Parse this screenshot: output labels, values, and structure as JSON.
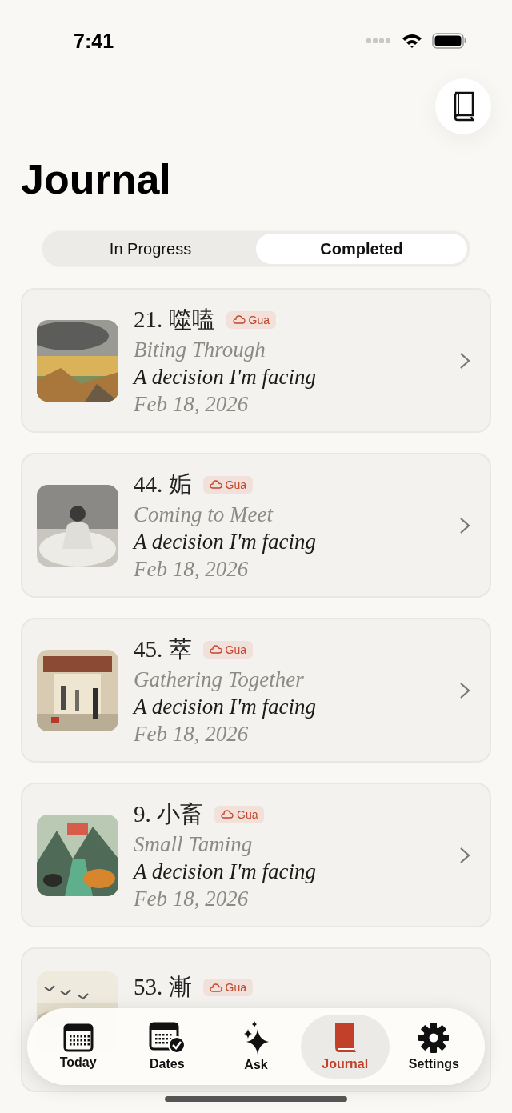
{
  "status_bar": {
    "time": "7:41"
  },
  "header": {
    "title": "Journal"
  },
  "segments": [
    {
      "label": "In Progress",
      "selected": false
    },
    {
      "label": "Completed",
      "selected": true
    }
  ],
  "entries": [
    {
      "number": "21.",
      "glyph": "噬嗑",
      "badge": "Gua",
      "name": "Biting Through",
      "question": "A decision I'm facing",
      "date": "Feb 18, 2026"
    },
    {
      "number": "44.",
      "glyph": "姤",
      "badge": "Gua",
      "name": "Coming to Meet",
      "question": "A decision I'm facing",
      "date": "Feb 18, 2026"
    },
    {
      "number": "45.",
      "glyph": "萃",
      "badge": "Gua",
      "name": "Gathering Together",
      "question": "A decision I'm facing",
      "date": "Feb 18, 2026"
    },
    {
      "number": "9.",
      "glyph": "小畜",
      "badge": "Gua",
      "name": "Small Taming",
      "question": "A decision I'm facing",
      "date": "Feb 18, 2026"
    },
    {
      "number": "53.",
      "glyph": "漸",
      "badge": "Gua"
    }
  ],
  "tabs": [
    {
      "kind": "today",
      "label": "Today",
      "selected": false
    },
    {
      "kind": "dates",
      "label": "Dates",
      "selected": false
    },
    {
      "kind": "ask",
      "label": "Ask",
      "selected": false
    },
    {
      "kind": "journal",
      "label": "Journal",
      "selected": true
    },
    {
      "kind": "settings",
      "label": "Settings",
      "selected": false
    }
  ]
}
